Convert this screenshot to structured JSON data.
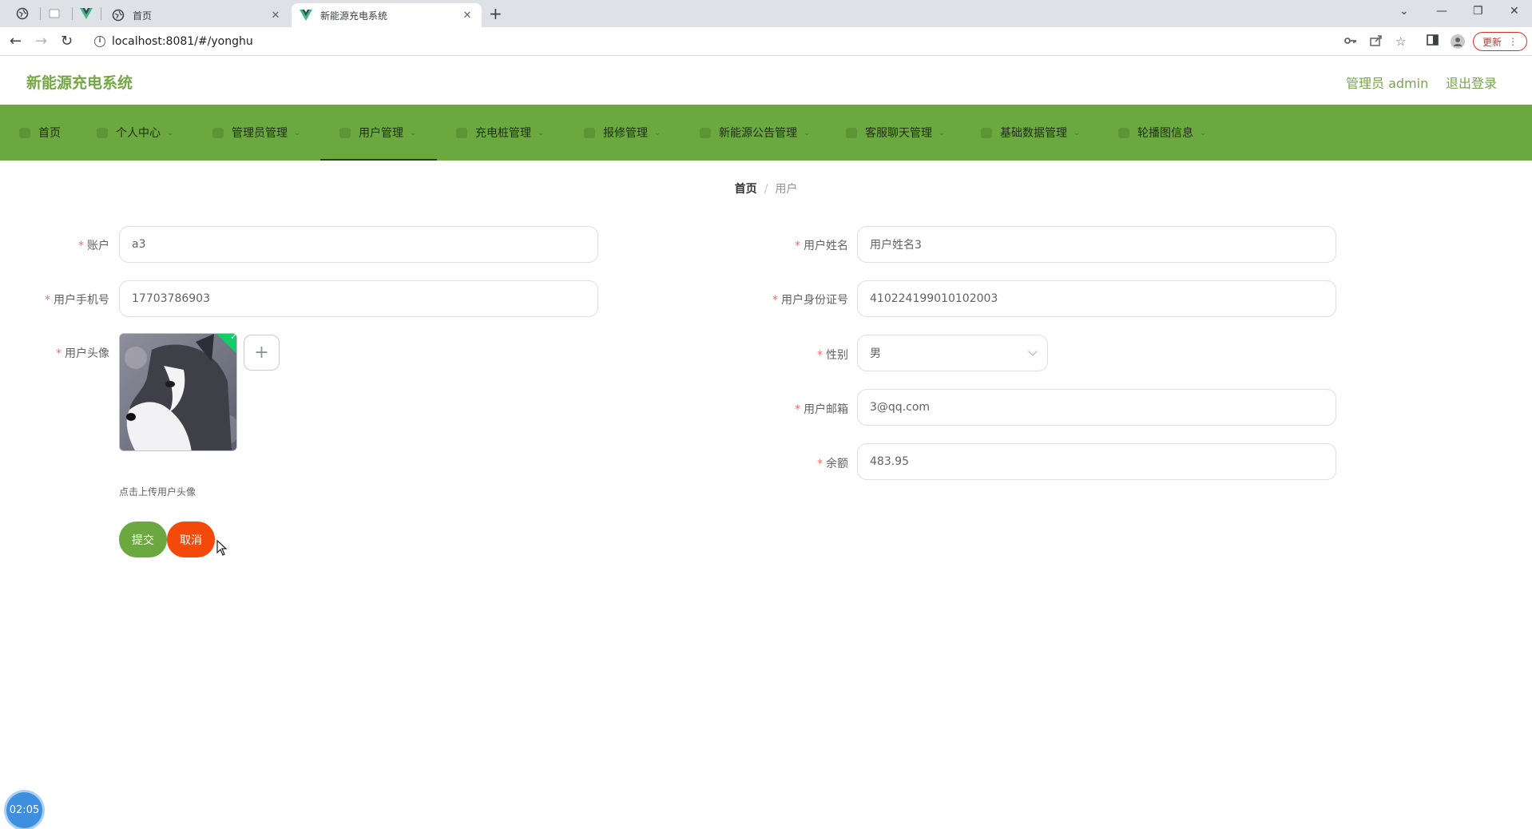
{
  "browser": {
    "tabs": [
      {
        "title": "首页",
        "active": false
      },
      {
        "title": "新能源充电系统",
        "active": true
      }
    ],
    "url": "localhost:8081/#/yonghu",
    "update_label": "更新"
  },
  "header": {
    "app_title": "新能源充电系统",
    "admin_label": "管理员 admin",
    "logout_label": "退出登录"
  },
  "nav": {
    "items": [
      {
        "label": "首页"
      },
      {
        "label": "个人中心"
      },
      {
        "label": "管理员管理"
      },
      {
        "label": "用户管理"
      },
      {
        "label": "充电桩管理"
      },
      {
        "label": "报修管理"
      },
      {
        "label": "新能源公告管理"
      },
      {
        "label": "客服聊天管理"
      },
      {
        "label": "基础数据管理"
      },
      {
        "label": "轮播图信息"
      }
    ],
    "active_index": 3
  },
  "breadcrumb": {
    "home": "首页",
    "separator": "/",
    "current": "用户"
  },
  "form": {
    "account": {
      "label": "账户",
      "value": "a3"
    },
    "user_name": {
      "label": "用户姓名",
      "value": "用户姓名3"
    },
    "phone": {
      "label": "用户手机号",
      "value": "17703786903"
    },
    "id_card": {
      "label": "用户身份证号",
      "value": "410224199010102003"
    },
    "avatar": {
      "label": "用户头像",
      "tip": "点击上传用户头像"
    },
    "gender": {
      "label": "性别",
      "value": "男"
    },
    "email": {
      "label": "用户邮箱",
      "value": "3@qq.com"
    },
    "balance": {
      "label": "余额",
      "value": "483.95"
    },
    "submit_label": "提交",
    "cancel_label": "取消"
  },
  "clock": {
    "time": "02:05"
  },
  "colors": {
    "brand_green": "#6ba83f",
    "cancel_red": "#f34a0c",
    "required": "#f56c6c"
  }
}
